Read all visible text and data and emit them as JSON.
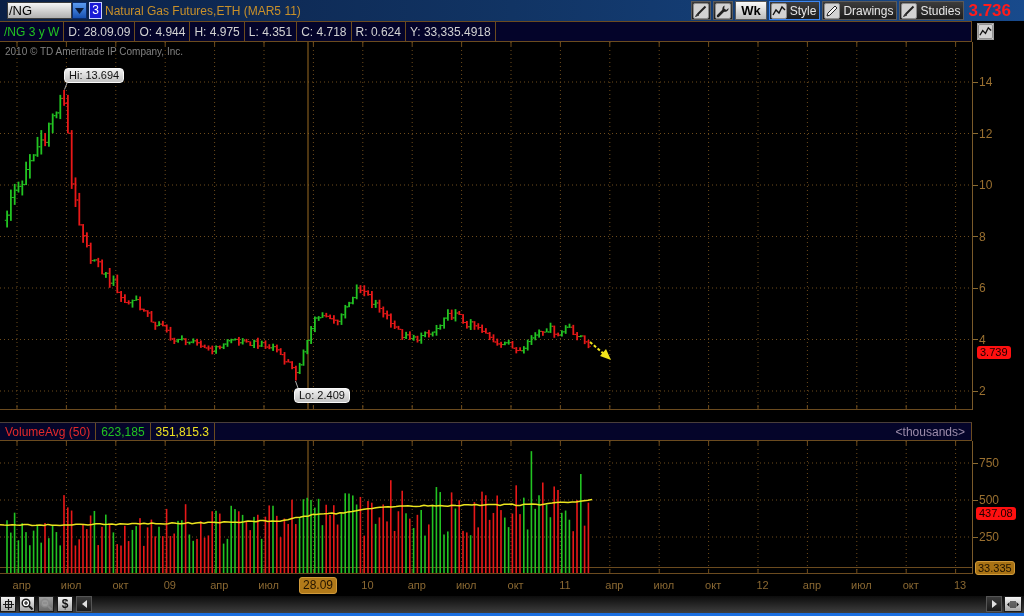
{
  "symbol_bar": {
    "symbol": "/NG",
    "link_number": "3",
    "instrument": "Natural Gas Futures,ETH (MAR5 11)",
    "tools": [
      {
        "kind": "drawing_tools",
        "focused": false
      },
      {
        "kind": "settings",
        "focused": false
      },
      {
        "kind": "aggregation",
        "label": "Wk",
        "focused": false
      },
      {
        "kind": "style",
        "label": "Style",
        "focused": true
      },
      {
        "kind": "drawings",
        "label": "Drawings",
        "focused": false
      },
      {
        "kind": "studies",
        "label": "Studies",
        "focused": false
      }
    ],
    "last_price": "3.736"
  },
  "info_bar": {
    "chart_label": "/NG 3 y W",
    "fields": [
      "D: 28.09.09",
      "O: 4.944",
      "H: 4.975",
      "L: 4.351",
      "C: 4.718",
      "R: 0.624",
      "Y: 33,335.4918"
    ]
  },
  "price_chart": {
    "copyright": "2010 © TD Ameritrade IP Company, Inc.",
    "high_label": "Hi: 13.694",
    "low_label": "Lo: 2.409",
    "y_ticks": [
      "14",
      "12",
      "10",
      "8",
      "6",
      "4",
      "2"
    ],
    "price_marker": "3.739"
  },
  "volume_study": {
    "title": "VolumeAvg (50)",
    "volume": "623,185",
    "average": "351,815.3",
    "units": "<thousands>",
    "y_ticks": [
      "750",
      "500",
      "250"
    ],
    "volume_marker": "437.08",
    "level_marker": "33.335"
  },
  "time_axis": {
    "labels": [
      {
        "kind": "tick",
        "text": "апр"
      },
      {
        "kind": "tick",
        "text": "июл"
      },
      {
        "kind": "tick",
        "text": "окт"
      },
      {
        "kind": "tick",
        "text": "09"
      },
      {
        "kind": "tick",
        "text": "апр"
      },
      {
        "kind": "tick",
        "text": "июл"
      },
      {
        "kind": "cursor",
        "text": "28.09"
      },
      {
        "kind": "tick",
        "text": "10"
      },
      {
        "kind": "tick",
        "text": "апр"
      },
      {
        "kind": "tick",
        "text": "июл"
      },
      {
        "kind": "tick",
        "text": "окт"
      },
      {
        "kind": "tick",
        "text": "11"
      },
      {
        "kind": "tick",
        "text": "апр"
      },
      {
        "kind": "tick",
        "text": "июл"
      },
      {
        "kind": "tick",
        "text": "окт"
      },
      {
        "kind": "tick",
        "text": "12"
      },
      {
        "kind": "tick",
        "text": "апр"
      },
      {
        "kind": "tick",
        "text": "июл"
      },
      {
        "kind": "tick",
        "text": "окт"
      },
      {
        "kind": "tick",
        "text": "13"
      }
    ]
  },
  "bottom_bar": {
    "buttons": [
      {
        "kind": "crosshair",
        "disabled": false
      },
      {
        "kind": "zoom_in",
        "disabled": false
      },
      {
        "kind": "zoom_out",
        "disabled": true
      },
      {
        "kind": "currency",
        "label": "$",
        "disabled": false
      },
      {
        "kind": "scroll_left",
        "disabled": false
      }
    ],
    "right_buttons": [
      {
        "kind": "scroll_right"
      },
      {
        "kind": "fit"
      }
    ]
  }
}
